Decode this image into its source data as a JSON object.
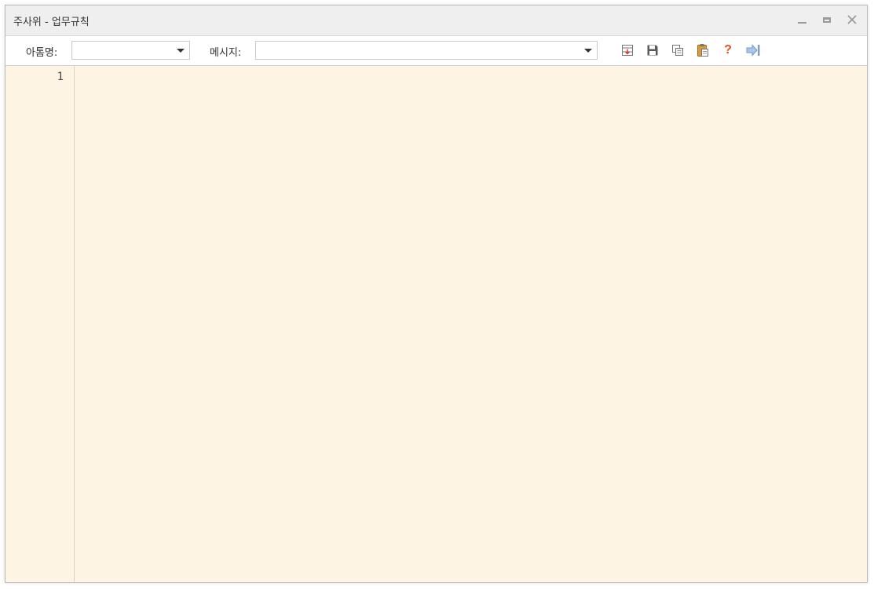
{
  "window": {
    "title": "주사위 - 업무규칙"
  },
  "toolbar": {
    "action_name_label": "아톰명:",
    "action_name_value": "",
    "message_label": "메시지:",
    "message_value": "",
    "icons": [
      "insert-icon",
      "save-icon",
      "copy-icon",
      "paste-icon",
      "help-icon",
      "exit-icon"
    ],
    "help_glyph": "?"
  },
  "editor": {
    "line_numbers": [
      "1"
    ],
    "content": ""
  },
  "colors": {
    "editor_background": "#fdf4e3",
    "help_icon": "#e0521b",
    "save_icon": "#5a5a5a"
  }
}
